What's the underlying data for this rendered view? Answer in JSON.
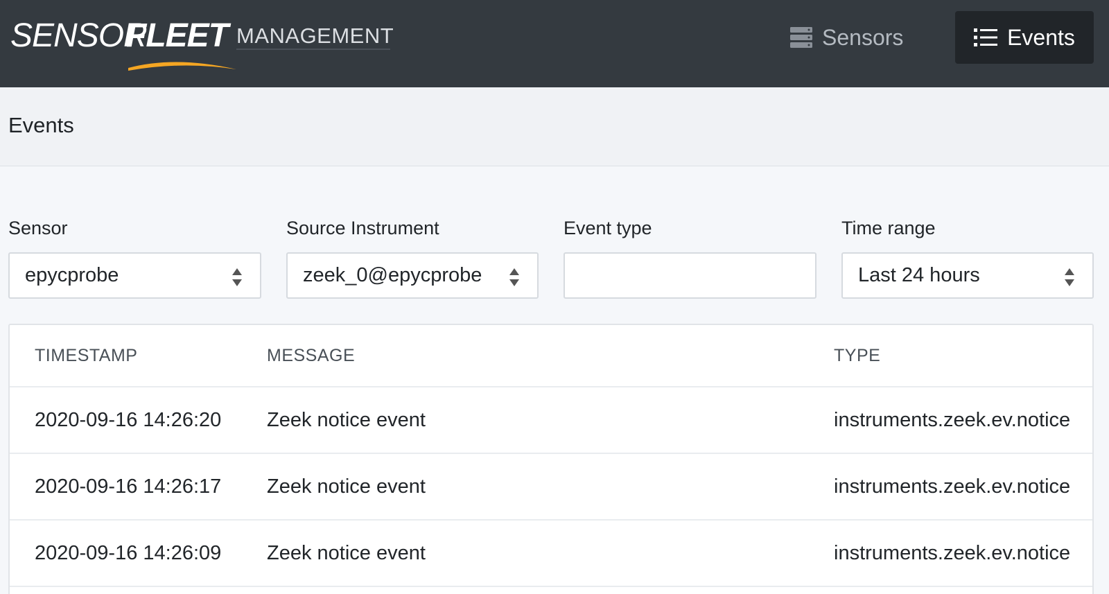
{
  "brand": {
    "logo_word1": "SENSOR",
    "logo_word2": "FLEET",
    "subtitle": "MANAGEMENT",
    "accent_color": "#f5a623"
  },
  "nav": {
    "sensors": {
      "label": "Sensors",
      "icon": "server-icon"
    },
    "events": {
      "label": "Events",
      "icon": "list-icon",
      "active": true
    }
  },
  "page": {
    "title": "Events"
  },
  "filters": {
    "sensor": {
      "label": "Sensor",
      "value": "epycprobe"
    },
    "source_instrument": {
      "label": "Source Instrument",
      "value": "zeek_0@epycprobe"
    },
    "event_type": {
      "label": "Event type",
      "value": ""
    },
    "time_range": {
      "label": "Time range",
      "value": "Last 24 hours"
    }
  },
  "table": {
    "columns": [
      "TIMESTAMP",
      "MESSAGE",
      "TYPE"
    ],
    "rows": [
      {
        "timestamp": "2020-09-16 14:26:20",
        "message": "Zeek notice event",
        "type": "instruments.zeek.ev.notice"
      },
      {
        "timestamp": "2020-09-16 14:26:17",
        "message": "Zeek notice event",
        "type": "instruments.zeek.ev.notice"
      },
      {
        "timestamp": "2020-09-16 14:26:09",
        "message": "Zeek notice event",
        "type": "instruments.zeek.ev.notice"
      }
    ]
  }
}
